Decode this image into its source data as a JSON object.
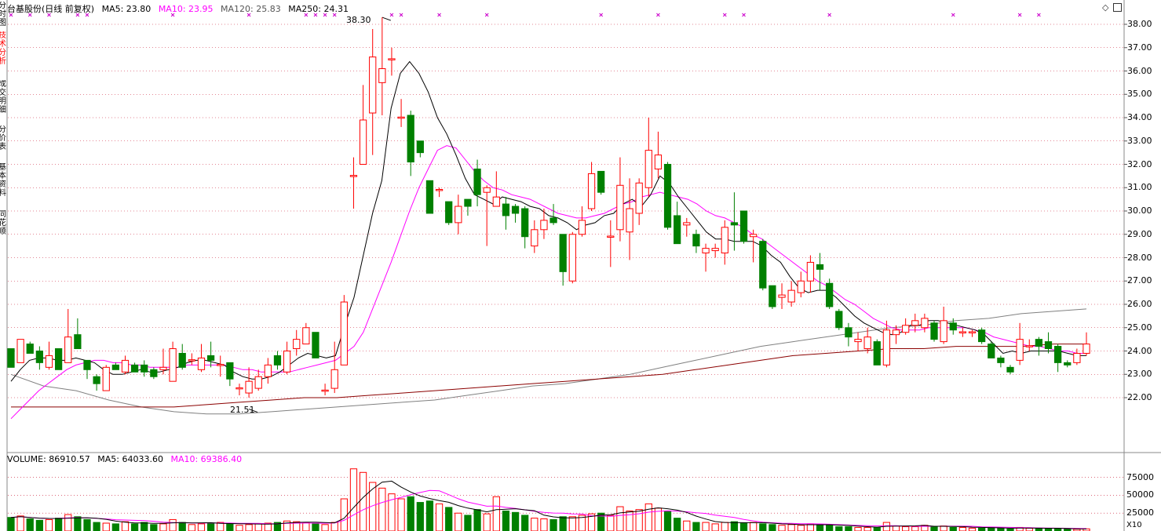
{
  "sidebar": {
    "tabs": [
      "分时图",
      "技术分析",
      "成交明细",
      "分价表",
      "基本资料",
      "同花顺"
    ]
  },
  "header": {
    "stock": "台基股份(日线 前复权)",
    "ma5": "MA5: 23.80",
    "ma10": "MA10: 23.95",
    "ma120": "MA120: 25.83",
    "ma250": "MA250: 24.31"
  },
  "volume_header": {
    "volume": "VOLUME: 86910.57",
    "ma5": "MA5: 64033.60",
    "ma10": "MA10: 69386.40"
  },
  "annotations": {
    "high": "38.30",
    "low": "21.51"
  },
  "price_axis": [
    "38.00",
    "37.00",
    "36.00",
    "35.00",
    "34.00",
    "33.00",
    "32.00",
    "31.00",
    "30.00",
    "29.00",
    "28.00",
    "27.00",
    "26.00",
    "25.00",
    "24.00",
    "23.00",
    "22.00"
  ],
  "volume_axis": [
    "75000",
    "50000",
    "25000"
  ],
  "volume_unit": "X10",
  "colors": {
    "up": "#ff0000",
    "down": "#008000",
    "ma5": "#000000",
    "ma10": "#ff00ff",
    "ma120": "#808080",
    "ma250": "#8b0000",
    "grid": "#c8102e"
  },
  "chart_data": {
    "type": "candlestick",
    "y_range": [
      21.0,
      38.3
    ],
    "volume_range": [
      0,
      90000
    ],
    "candles": [
      [
        24.1,
        23.3,
        24.1,
        23.3
      ],
      [
        23.5,
        24.5,
        24.5,
        23.5
      ],
      [
        24.3,
        23.9,
        24.4,
        23.9
      ],
      [
        24.0,
        23.5,
        24.2,
        23.2
      ],
      [
        23.3,
        23.8,
        24.4,
        23.2
      ],
      [
        24.1,
        23.2,
        24.1,
        23.2
      ],
      [
        23.5,
        24.6,
        25.8,
        23.5
      ],
      [
        24.7,
        24.1,
        25.4,
        24.1
      ],
      [
        23.6,
        23.2,
        23.6,
        22.8
      ],
      [
        22.9,
        22.6,
        23.0,
        22.3
      ],
      [
        22.3,
        23.3,
        23.4,
        22.3
      ],
      [
        23.4,
        23.2,
        23.5,
        23.2
      ],
      [
        23.1,
        23.6,
        23.8,
        23.0
      ],
      [
        23.4,
        23.1,
        23.5,
        23.1
      ],
      [
        23.4,
        23.1,
        23.6,
        22.9
      ],
      [
        23.2,
        22.9,
        23.3,
        22.8
      ],
      [
        23.2,
        23.3,
        24.1,
        23.0
      ],
      [
        22.7,
        24.1,
        24.4,
        22.7
      ],
      [
        23.9,
        23.3,
        24.3,
        23.2
      ],
      [
        23.6,
        23.6,
        23.9,
        23.4
      ],
      [
        23.2,
        23.7,
        24.3,
        23.1
      ],
      [
        23.8,
        23.6,
        24.4,
        23.3
      ],
      [
        23.4,
        23.4,
        23.8,
        22.9
      ],
      [
        23.5,
        22.8,
        23.5,
        22.5
      ],
      [
        22.4,
        22.4,
        22.6,
        22.1
      ],
      [
        22.2,
        22.7,
        23.3,
        22.0
      ],
      [
        22.4,
        22.9,
        23.2,
        22.3
      ],
      [
        22.9,
        23.4,
        23.7,
        22.6
      ],
      [
        23.8,
        23.4,
        24.0,
        23.2
      ],
      [
        23.1,
        24.0,
        24.4,
        23.0
      ],
      [
        24.1,
        24.5,
        24.9,
        23.8
      ],
      [
        24.3,
        25.0,
        25.2,
        24.4
      ],
      [
        24.8,
        23.7,
        24.7,
        23.8
      ],
      [
        22.3,
        22.3,
        22.6,
        22.1
      ],
      [
        22.4,
        23.2,
        24.4,
        22.2
      ],
      [
        23.4,
        26.1,
        26.4,
        23.5
      ],
      [
        31.5,
        31.5,
        32.3,
        30.1
      ],
      [
        32.0,
        33.9,
        35.4,
        32.0
      ],
      [
        34.2,
        36.6,
        37.8,
        32.4
      ],
      [
        35.5,
        36.1,
        38.3,
        34.1
      ],
      [
        36.5,
        36.5,
        37.0,
        35.8
      ],
      [
        34.0,
        34.0,
        34.8,
        33.6
      ],
      [
        34.1,
        32.1,
        34.3,
        31.5
      ],
      [
        33.0,
        32.5,
        33.0,
        32.3
      ],
      [
        31.3,
        29.9,
        31.3,
        29.9
      ],
      [
        30.9,
        30.9,
        31.0,
        30.6
      ],
      [
        30.4,
        29.5,
        30.4,
        29.4
      ],
      [
        29.5,
        30.2,
        30.7,
        29.0
      ],
      [
        30.5,
        30.2,
        30.5,
        29.8
      ],
      [
        31.8,
        30.7,
        32.2,
        30.2
      ],
      [
        30.8,
        31.0,
        31.1,
        28.5
      ],
      [
        30.2,
        30.6,
        31.7,
        30.2
      ],
      [
        30.3,
        29.8,
        30.6,
        29.2
      ],
      [
        30.2,
        29.9,
        30.3,
        29.5
      ],
      [
        30.1,
        28.9,
        30.2,
        28.4
      ],
      [
        28.5,
        29.2,
        29.6,
        28.2
      ],
      [
        29.2,
        29.6,
        30.1,
        28.8
      ],
      [
        29.7,
        29.5,
        30.3,
        29.4
      ],
      [
        29.0,
        27.4,
        29.0,
        26.8
      ],
      [
        27.0,
        29.0,
        29.1,
        26.9
      ],
      [
        29.0,
        29.6,
        30.2,
        28.9
      ],
      [
        30.1,
        31.6,
        32.1,
        30.0
      ],
      [
        31.7,
        30.8,
        31.7,
        30.7
      ],
      [
        28.9,
        28.9,
        29.6,
        27.6
      ],
      [
        29.2,
        31.1,
        32.3,
        28.7
      ],
      [
        29.1,
        30.1,
        31.4,
        27.9
      ],
      [
        29.9,
        31.2,
        31.4,
        29.4
      ],
      [
        31.0,
        32.6,
        34.0,
        30.6
      ],
      [
        31.8,
        32.4,
        33.4,
        31.4
      ],
      [
        32.0,
        29.3,
        32.1,
        29.2
      ],
      [
        29.8,
        28.6,
        30.4,
        28.7
      ],
      [
        29.4,
        29.5,
        29.7,
        28.9
      ],
      [
        29.0,
        28.5,
        29.2,
        28.2
      ],
      [
        28.2,
        28.4,
        28.6,
        27.4
      ],
      [
        28.3,
        28.4,
        28.6,
        28.0
      ],
      [
        28.2,
        29.3,
        29.6,
        27.7
      ],
      [
        29.5,
        29.4,
        30.8,
        28.3
      ],
      [
        30.0,
        28.7,
        29.9,
        28.6
      ],
      [
        28.9,
        29.0,
        29.2,
        27.8
      ],
      [
        28.7,
        26.7,
        28.8,
        26.6
      ],
      [
        26.8,
        25.9,
        26.8,
        25.8
      ],
      [
        26.3,
        26.4,
        26.9,
        25.8
      ],
      [
        26.1,
        26.6,
        27.0,
        25.9
      ],
      [
        26.5,
        27.0,
        27.4,
        26.3
      ],
      [
        27.0,
        27.8,
        28.1,
        26.5
      ],
      [
        27.7,
        27.5,
        28.2,
        26.6
      ],
      [
        26.9,
        25.9,
        27.1,
        25.8
      ],
      [
        25.7,
        25.0,
        25.8,
        24.9
      ],
      [
        25.0,
        24.6,
        25.2,
        24.2
      ],
      [
        24.4,
        24.5,
        24.8,
        24.0
      ],
      [
        24.1,
        24.6,
        25.0,
        23.9
      ],
      [
        24.4,
        23.4,
        24.5,
        23.4
      ],
      [
        23.4,
        24.9,
        25.3,
        23.3
      ],
      [
        24.7,
        24.9,
        25.1,
        24.3
      ],
      [
        24.8,
        25.1,
        25.4,
        24.7
      ],
      [
        25.1,
        25.3,
        25.6,
        24.8
      ],
      [
        25.0,
        25.4,
        25.6,
        24.8
      ],
      [
        25.2,
        24.5,
        25.3,
        24.4
      ],
      [
        24.4,
        25.3,
        25.9,
        24.3
      ],
      [
        25.2,
        24.9,
        25.4,
        24.7
      ],
      [
        24.8,
        24.8,
        25.0,
        24.6
      ],
      [
        24.8,
        24.8,
        24.9,
        24.6
      ],
      [
        24.9,
        24.4,
        25.0,
        24.3
      ],
      [
        24.3,
        23.7,
        24.4,
        23.7
      ],
      [
        23.7,
        23.5,
        23.8,
        23.3
      ],
      [
        23.3,
        23.1,
        23.4,
        23.0
      ],
      [
        23.6,
        24.5,
        25.2,
        23.4
      ],
      [
        24.2,
        24.2,
        24.5,
        24.0
      ],
      [
        24.5,
        24.2,
        24.6,
        23.8
      ],
      [
        24.4,
        24.1,
        24.8,
        23.9
      ],
      [
        24.2,
        23.5,
        24.3,
        23.1
      ],
      [
        23.5,
        23.4,
        23.6,
        23.3
      ],
      [
        23.5,
        23.9,
        24.1,
        23.4
      ],
      [
        23.9,
        24.3,
        24.8,
        23.8
      ]
    ],
    "volumes": [
      19000,
      21000,
      17000,
      15000,
      16000,
      18000,
      23000,
      20000,
      16000,
      12000,
      11000,
      10000,
      13000,
      10000,
      12000,
      9000,
      10000,
      16000,
      12000,
      9000,
      10000,
      11000,
      12000,
      10000,
      8000,
      9000,
      10000,
      11000,
      12000,
      14000,
      13000,
      12000,
      11000,
      9000,
      12000,
      45000,
      87000,
      82000,
      68000,
      60000,
      52000,
      45000,
      48000,
      40000,
      42000,
      38000,
      33000,
      25000,
      22000,
      30000,
      24000,
      48000,
      28000,
      26000,
      22000,
      18000,
      17000,
      16000,
      20000,
      20000,
      22000,
      24000,
      25000,
      22000,
      34000,
      28000,
      30000,
      38000,
      32000,
      28000,
      18000,
      14000,
      12000,
      12000,
      10000,
      12000,
      13000,
      11000,
      12000,
      10000,
      9000,
      8000,
      9000,
      8000,
      10000,
      9000,
      8000,
      6000,
      6000,
      5000,
      5000,
      5000,
      12000,
      7000,
      6000,
      6000,
      8000,
      6000,
      7000,
      5000,
      5000,
      4000,
      4000,
      5000,
      4000,
      3000,
      5000,
      4000,
      4000,
      3000,
      3000,
      3000,
      2500,
      3000
    ],
    "ma5": [
      22.7,
      23.2,
      23.6,
      23.7,
      23.7,
      23.6,
      23.6,
      23.7,
      23.6,
      23.5,
      23.2,
      23.0,
      23.0,
      23.1,
      23.2,
      23.1,
      23.1,
      23.2,
      23.3,
      23.5,
      23.6,
      23.6,
      23.5,
      23.4,
      23.1,
      22.9,
      22.8,
      22.8,
      22.9,
      23.1,
      23.4,
      23.7,
      23.9,
      23.8,
      23.7,
      23.8,
      25.1,
      26.3,
      28.1,
      29.9,
      31.3,
      34.4,
      35.9,
      36.4,
      35.9,
      35.1,
      34.0,
      33.3,
      32.4,
      31.4,
      30.7,
      30.5,
      30.3,
      30.6,
      30.5,
      30.4,
      30.2,
      30.1,
      29.8,
      29.7,
      29.5,
      29.2,
      29.4,
      29.5,
      29.8,
      29.9,
      30.3,
      30.5,
      30.2,
      30.7,
      31.5,
      31.2,
      30.6,
      30.1,
      29.6,
      29.1,
      28.8,
      28.8,
      28.7,
      28.7,
      28.7,
      28.5,
      28.1,
      27.8,
      27.2,
      26.7,
      26.5,
      26.6,
      26.6,
      26.3,
      25.9,
      25.5,
      25.2,
      25.0,
      24.8,
      24.7,
      24.8,
      25.1,
      25.1,
      25.3,
      25.3,
      25.2,
      25.1,
      25.0,
      24.9,
      24.7,
      24.3,
      23.9,
      24.0,
      23.9,
      24.0,
      24.0,
      24.0,
      24.0,
      23.9,
      23.8,
      23.8
    ],
    "ma10": [
      21.1,
      21.5,
      21.9,
      22.3,
      22.6,
      22.9,
      23.2,
      23.4,
      23.5,
      23.6,
      23.6,
      23.5,
      23.5,
      23.4,
      23.4,
      23.3,
      23.3,
      23.3,
      23.3,
      23.4,
      23.4,
      23.4,
      23.4,
      23.4,
      23.3,
      23.2,
      23.2,
      23.1,
      23.1,
      23.1,
      23.1,
      23.2,
      23.3,
      23.4,
      23.5,
      23.6,
      23.9,
      24.2,
      24.8,
      25.8,
      26.8,
      27.8,
      28.9,
      30.0,
      31.0,
      31.8,
      32.6,
      32.8,
      32.7,
      32.2,
      31.7,
      31.3,
      31.0,
      30.9,
      30.7,
      30.6,
      30.5,
      30.3,
      30.1,
      29.9,
      29.8,
      29.7,
      29.7,
      29.8,
      29.9,
      30.1,
      30.3,
      30.4,
      30.6,
      30.7,
      30.8,
      30.7,
      30.6,
      30.5,
      30.3,
      30.0,
      29.8,
      29.7,
      29.5,
      29.3,
      29.0,
      28.8,
      28.5,
      28.2,
      27.9,
      27.6,
      27.3,
      27.0,
      26.8,
      26.5,
      26.2,
      26.0,
      25.7,
      25.4,
      25.2,
      25.0,
      24.9,
      24.9,
      24.9,
      25.0,
      25.0,
      25.0,
      25.0,
      25.0,
      24.9,
      24.8,
      24.6,
      24.5,
      24.4,
      24.3,
      24.2,
      24.2,
      24.1,
      24.0,
      24.0,
      23.9,
      23.9
    ],
    "ma120": [
      23.0,
      22.5,
      22.3,
      21.9,
      21.6,
      21.4,
      21.3,
      21.3,
      21.4,
      21.5,
      21.6,
      21.7,
      21.8,
      21.9,
      22.1,
      22.3,
      22.5,
      22.6,
      22.8,
      23.0,
      23.3,
      23.6,
      23.9,
      24.2,
      24.4,
      24.6,
      24.8,
      25.0,
      25.1,
      25.3,
      25.4,
      25.6,
      25.7,
      25.8
    ],
    "ma250": [
      21.6,
      21.6,
      21.6,
      21.6,
      21.6,
      21.6,
      21.7,
      21.8,
      21.9,
      22.0,
      22.0,
      22.1,
      22.2,
      22.3,
      22.4,
      22.5,
      22.6,
      22.7,
      22.8,
      22.9,
      23.0,
      23.2,
      23.4,
      23.6,
      23.8,
      23.9,
      24.0,
      24.1,
      24.1,
      24.2,
      24.2,
      24.2,
      24.3,
      24.3
    ],
    "high": {
      "index": 39,
      "value": 38.3
    },
    "low": {
      "index": 25,
      "value": 21.51
    }
  }
}
